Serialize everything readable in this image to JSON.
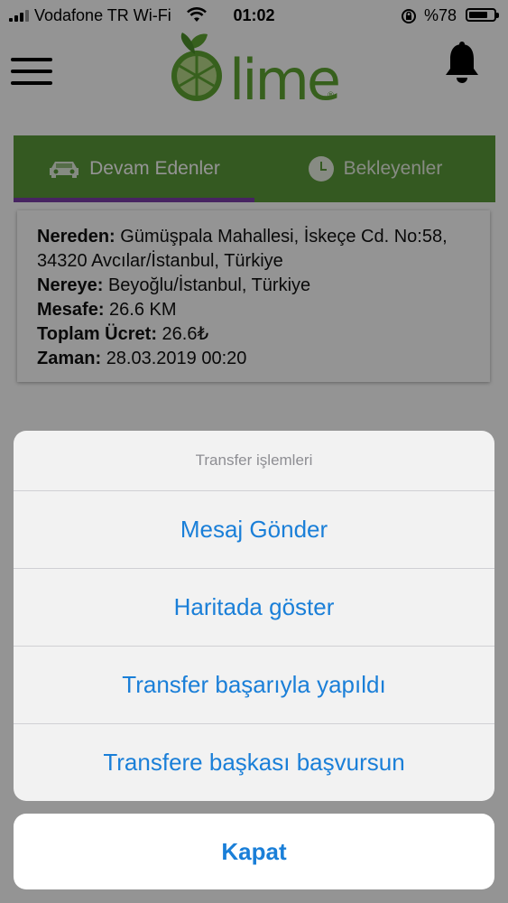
{
  "status_bar": {
    "carrier": "Vodafone TR Wi-Fi",
    "time": "01:02",
    "battery_text": "%78",
    "battery_level": 0.78,
    "icons": [
      "signal-icon",
      "wifi-icon",
      "orientation-lock-icon",
      "battery-icon"
    ]
  },
  "header": {
    "logo_text": "lime",
    "logo_mark": "®",
    "icons": [
      "hamburger-menu-icon",
      "lime-logo",
      "bell-icon"
    ]
  },
  "tabs": [
    {
      "label": "Devam Edenler",
      "icon": "car-icon",
      "active": true
    },
    {
      "label": "Bekleyenler",
      "icon": "clock-icon",
      "active": false
    }
  ],
  "transfer": {
    "from_label": "Nereden:",
    "from_value": "Gümüşpala Mahallesi, İskeçe Cd. No:58, 34320 Avcılar/İstanbul, Türkiye",
    "to_label": "Nereye:",
    "to_value": "Beyoğlu/İstanbul, Türkiye",
    "distance_label": "Mesafe:",
    "distance_value": "26.6 KM",
    "price_label": "Toplam Ücret:",
    "price_value": "26.6₺",
    "time_label": "Zaman:",
    "time_value": "28.03.2019 00:20"
  },
  "action_sheet": {
    "title": "Transfer işlemleri",
    "actions": [
      "Mesaj Gönder",
      "Haritada göster",
      "Transfer başarıyla yapıldı",
      "Transfere başkası başvursun"
    ],
    "cancel": "Kapat"
  },
  "colors": {
    "brand_green": "#5b9a3a",
    "tab_indicator": "#7b3fa8",
    "ios_blue": "#1a7fd8",
    "overlay": "rgba(0,0,0,0.42)"
  }
}
